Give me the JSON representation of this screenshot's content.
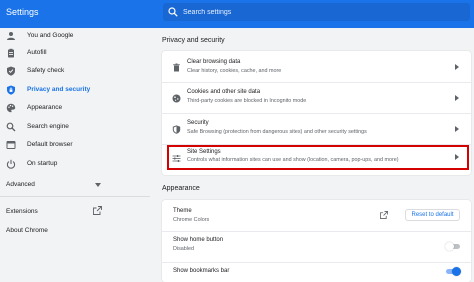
{
  "header": {
    "title": "Settings",
    "search_placeholder": "Search settings"
  },
  "sidebar": {
    "items": [
      {
        "label": "You and Google",
        "icon": "person-icon"
      },
      {
        "label": "Autofill",
        "icon": "clipboard-icon"
      },
      {
        "label": "Safety check",
        "icon": "shield-icon"
      },
      {
        "label": "Privacy and security",
        "icon": "shield-lock-icon",
        "active": true
      },
      {
        "label": "Appearance",
        "icon": "palette-icon"
      },
      {
        "label": "Search engine",
        "icon": "search-icon"
      },
      {
        "label": "Default browser",
        "icon": "browser-icon"
      },
      {
        "label": "On startup",
        "icon": "power-icon"
      }
    ],
    "advanced_label": "Advanced",
    "extensions_label": "Extensions",
    "about_label": "About Chrome"
  },
  "privacy": {
    "section_title": "Privacy and security",
    "rows": [
      {
        "title": "Clear browsing data",
        "desc": "Clear history, cookies, cache, and more",
        "icon": "trash-icon"
      },
      {
        "title": "Cookies and other site data",
        "desc": "Third-party cookies are blocked in Incognito mode",
        "icon": "cookie-icon"
      },
      {
        "title": "Security",
        "desc": "Safe Browsing (protection from dangerous sites) and other security settings",
        "icon": "shield-icon"
      },
      {
        "title": "Site Settings",
        "desc": "Controls what information sites can use and show (location, camera, pop-ups, and more)",
        "icon": "sliders-icon"
      }
    ]
  },
  "appearance": {
    "section_title": "Appearance",
    "theme_title": "Theme",
    "theme_value": "Chrome Colors",
    "reset_label": "Reset to default",
    "home_title": "Show home button",
    "home_value": "Disabled",
    "home_toggle": false,
    "bookmarks_title": "Show bookmarks bar",
    "bookmarks_toggle": true
  },
  "colors": {
    "accent": "#1a73e8",
    "highlight_box": "#d50000"
  }
}
